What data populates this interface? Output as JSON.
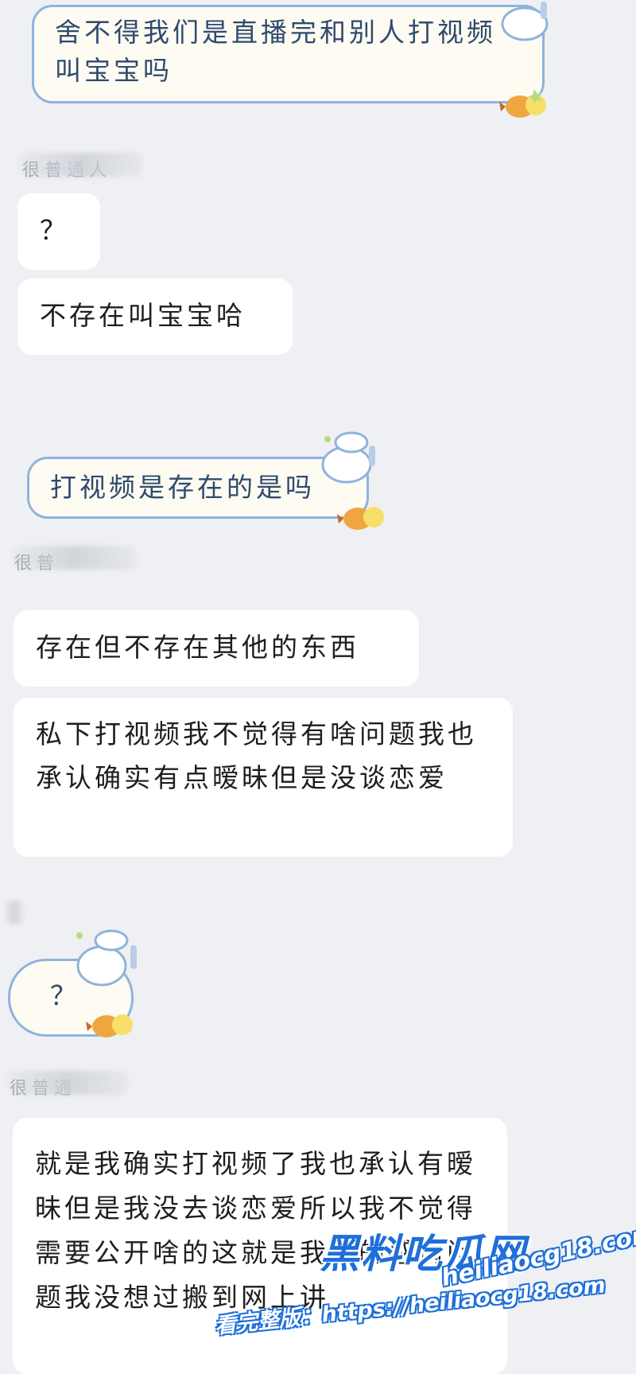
{
  "messages": [
    {
      "text": "舍不得我们是直播完和别人打视频叫宝宝吗"
    },
    {
      "sender": "很普通人"
    },
    {
      "text": "？"
    },
    {
      "text": "不存在叫宝宝哈"
    },
    {
      "text": "打视频是存在的是吗"
    },
    {
      "sender": "很普"
    },
    {
      "text": "存在但不存在其他的东西"
    },
    {
      "text": "私下打视频我不觉得有啥问题我也承认确实有点暧昧但是没谈恋爱"
    },
    {
      "text": "？"
    },
    {
      "sender": "很普通"
    },
    {
      "text": "就是我确实打视频了我也承认有暧昧但是我没去谈恋爱所以我不觉得需要公开啥的这就是我们的感情问题我没想过搬到网上讲"
    }
  ],
  "watermark": {
    "site_name": "黑料吃瓜网",
    "url": "heiliaocg18.com",
    "caption": "看完整版：https://heiliaocg18.com"
  },
  "colors": {
    "background": "#eff0f4",
    "bubble": "#ffffff",
    "cloud_border": "#8fb3db",
    "cloud_text": "#2f4a6e",
    "watermark_blue": "#1e6fd9"
  }
}
